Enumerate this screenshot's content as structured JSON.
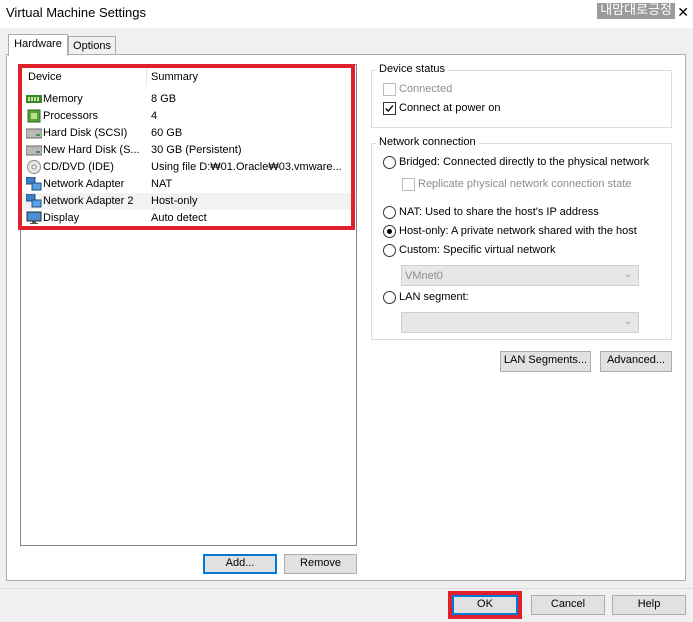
{
  "window": {
    "title": "Virtual Machine Settings",
    "watermark": "내맘대로긍정",
    "close_glyph": "✕"
  },
  "tabs": [
    {
      "label": "Hardware",
      "active": true
    },
    {
      "label": "Options",
      "active": false
    }
  ],
  "device_list": {
    "header_device": "Device",
    "header_summary": "Summary",
    "rows": [
      {
        "device": "Memory",
        "summary": "8 GB",
        "icon": "memory-icon"
      },
      {
        "device": "Processors",
        "summary": "4",
        "icon": "processor-icon"
      },
      {
        "device": "Hard Disk (SCSI)",
        "summary": "60 GB",
        "icon": "hard-disk-icon"
      },
      {
        "device": "New Hard Disk (S...",
        "summary": "30 GB (Persistent)",
        "icon": "hard-disk-icon"
      },
      {
        "device": "CD/DVD (IDE)",
        "summary": "Using file D:₩01.Oracle₩03.vmware...",
        "icon": "cd-dvd-icon"
      },
      {
        "device": "Network Adapter",
        "summary": "NAT",
        "icon": "network-adapter-icon"
      },
      {
        "device": "Network Adapter 2",
        "summary": "Host-only",
        "icon": "network-adapter-icon",
        "selected": true
      },
      {
        "device": "Display",
        "summary": "Auto detect",
        "icon": "display-icon"
      }
    ]
  },
  "buttons": {
    "add": "Add...",
    "remove": "Remove",
    "lan_segments": "LAN Segments...",
    "advanced": "Advanced...",
    "ok": "OK",
    "cancel": "Cancel",
    "help": "Help"
  },
  "device_status": {
    "legend": "Device status",
    "connected": {
      "label": "Connected",
      "checked": false,
      "disabled": true
    },
    "connect_at_power_on": {
      "label": "Connect at power on",
      "checked": true
    }
  },
  "network_connection": {
    "legend": "Network connection",
    "bridged": {
      "label": "Bridged: Connected directly to the physical network",
      "checked": false
    },
    "replicate": {
      "label": "Replicate physical network connection state",
      "checked": false,
      "disabled": true
    },
    "nat": {
      "label": "NAT: Used to share the host's IP address",
      "checked": false
    },
    "host_only": {
      "label": "Host-only: A private network shared with the host",
      "checked": true
    },
    "custom": {
      "label": "Custom: Specific virtual network",
      "checked": false
    },
    "custom_select_value": "VMnet0",
    "lan_segment": {
      "label": "LAN segment:",
      "checked": false
    },
    "lan_segment_select_value": ""
  },
  "colors": {
    "highlight": "#e0202a",
    "default_button_border": "#0078d7"
  }
}
